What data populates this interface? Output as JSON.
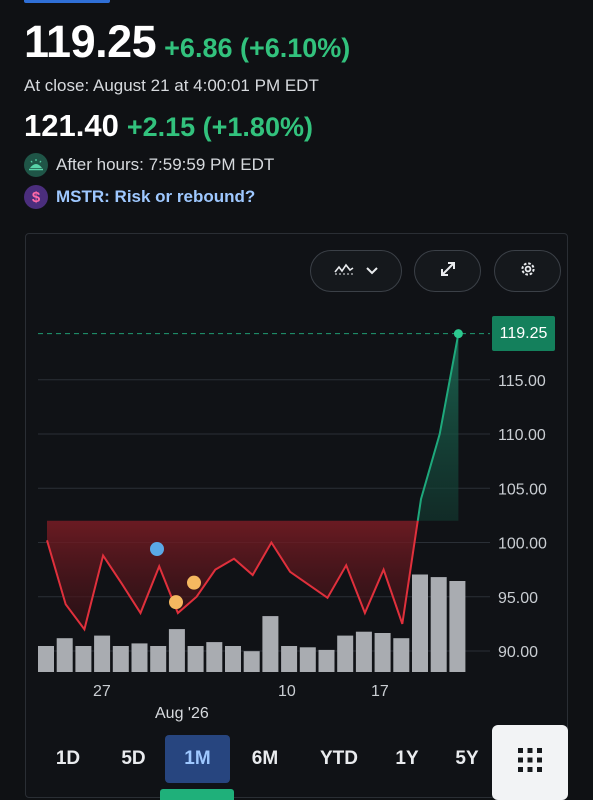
{
  "quote": {
    "price": "119.25",
    "change": "+6.86 (+6.10%)",
    "close_label": "At close: August 21 at 4:00:01 PM EDT",
    "after_price": "121.40",
    "after_change": "+2.15 (+1.80%)",
    "after_hours_label": "After hours: 7:59:59 PM EDT",
    "promo_label": "MSTR: Risk or rebound?"
  },
  "icons": {
    "after_hours": "moon-icon",
    "promo": "dollar-coin-icon",
    "chart_type": "line-chart-icon",
    "dropdown": "chevron-down-icon",
    "expand": "expand-icon",
    "settings": "gear-icon",
    "more": "grid-dots-icon"
  },
  "colors": {
    "positive": "#32c27d",
    "negative_line": "#e0303c",
    "current_tag": "#14805c",
    "active_range": "#27457f"
  },
  "chart_data": {
    "type": "line",
    "ylim": [
      88.5,
      121
    ],
    "yticks": [
      "90.00",
      "95.00",
      "100.00",
      "105.00",
      "110.00",
      "115.00"
    ],
    "current_price_label": "119.25",
    "baseline": 102,
    "x_tick_labels": [
      "27",
      "10",
      "17"
    ],
    "month_label": "Aug '26",
    "series": [
      {
        "values": [
          100.2,
          94.3,
          92.0,
          98.8,
          96.2,
          93.5,
          97.8,
          93.5,
          95.0,
          97.5,
          98.5,
          97.0,
          100.0,
          97.3,
          96.1,
          94.9,
          97.9,
          93.5,
          97.5,
          92.5,
          104.0,
          110.0,
          119.25
        ]
      }
    ],
    "volume_relative": [
      0.2,
      0.26,
      0.2,
      0.28,
      0.2,
      0.22,
      0.2,
      0.33,
      0.2,
      0.23,
      0.2,
      0.16,
      0.43,
      0.2,
      0.19,
      0.17,
      0.28,
      0.31,
      0.3,
      0.26,
      0.75,
      0.73,
      0.7
    ],
    "event_markers": [
      {
        "type": "blue",
        "value": 99.4
      },
      {
        "type": "orange",
        "value": 94.5
      },
      {
        "type": "orange",
        "value": 96.3
      }
    ]
  },
  "ranges": [
    "1D",
    "5D",
    "1M",
    "6M",
    "YTD",
    "1Y",
    "5Y"
  ],
  "active_range": "1M"
}
